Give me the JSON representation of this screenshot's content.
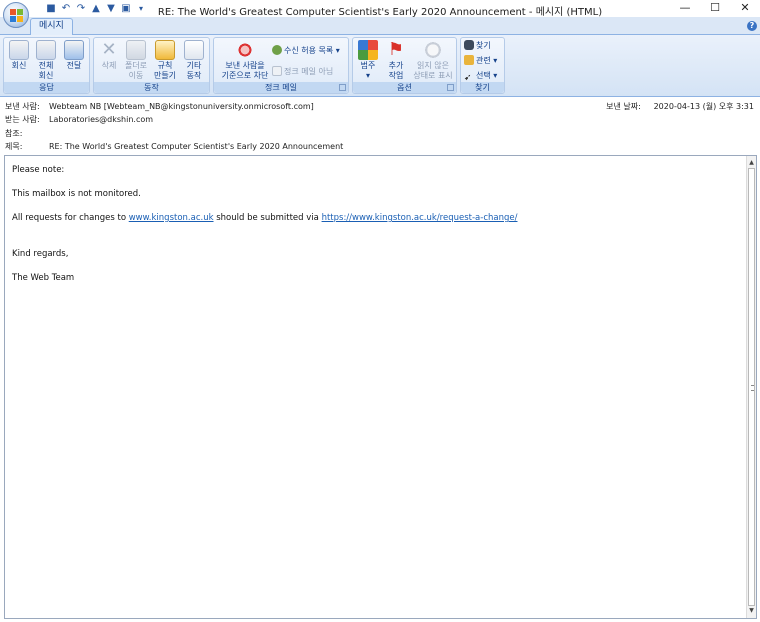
{
  "window": {
    "title": "RE: The World's Greatest Computer Scientist's Early 2020 Announcement - 메시지 (HTML)",
    "controls": {
      "minimize": "—",
      "maximize": "☐",
      "close": "✕"
    }
  },
  "ribbon": {
    "active_tab": "메시지",
    "groups": {
      "respond": {
        "label": "응답",
        "reply": "회신",
        "reply_all_1": "전체",
        "reply_all_2": "회신",
        "forward": "전달"
      },
      "actions": {
        "label": "동작",
        "delete": "삭제",
        "move_1": "폴더로",
        "move_2": "이동",
        "rules_1": "규칙",
        "rules_2": "만들기",
        "other_1": "기타",
        "other_2": "동작"
      },
      "junk": {
        "label": "정크 메일",
        "block_1": "보낸 사람을",
        "block_2": "기준으로 차단",
        "safe_lists": "수신 허용 목록",
        "not_junk": "정크 메일 아님"
      },
      "options": {
        "label": "옵션",
        "categorize": "범주",
        "followup_1": "추가",
        "followup_2": "작업",
        "mark_unread_1": "읽지 않은",
        "mark_unread_2": "상태로 표시"
      },
      "find": {
        "label": "찾기",
        "find": "찾기",
        "related": "관련",
        "select": "선택"
      }
    }
  },
  "header": {
    "from_label": "보낸 사람:",
    "from_value": "Webteam NB [Webteam_NB@kingstonuniversity.onmicrosoft.com]",
    "to_label": "받는 사람:",
    "to_value": "Laboratories@dkshin.com",
    "cc_label": "참조:",
    "cc_value": "",
    "subject_label": "제목:",
    "subject_value": "RE: The World's Greatest Computer Scientist's Early 2020 Announcement",
    "sent_label": "보낸 날짜:",
    "sent_value": "2020-04-13 (월) 오후 3:31"
  },
  "body": {
    "line1": "Please note:",
    "line2": "This mailbox is not monitored.",
    "line3_prefix": "All requests for changes to ",
    "line3_link1": "www.kingston.ac.uk",
    "line3_middle": " should be submitted via ",
    "line3_link2": "https://www.kingston.ac.uk/request-a-change/",
    "closing": "Kind regards,",
    "signature": "The Web Team"
  },
  "colors": {
    "ribbon_text": "#15428b",
    "link": "#1a5fb4",
    "ribbon_bg": "#dbe7f6"
  }
}
